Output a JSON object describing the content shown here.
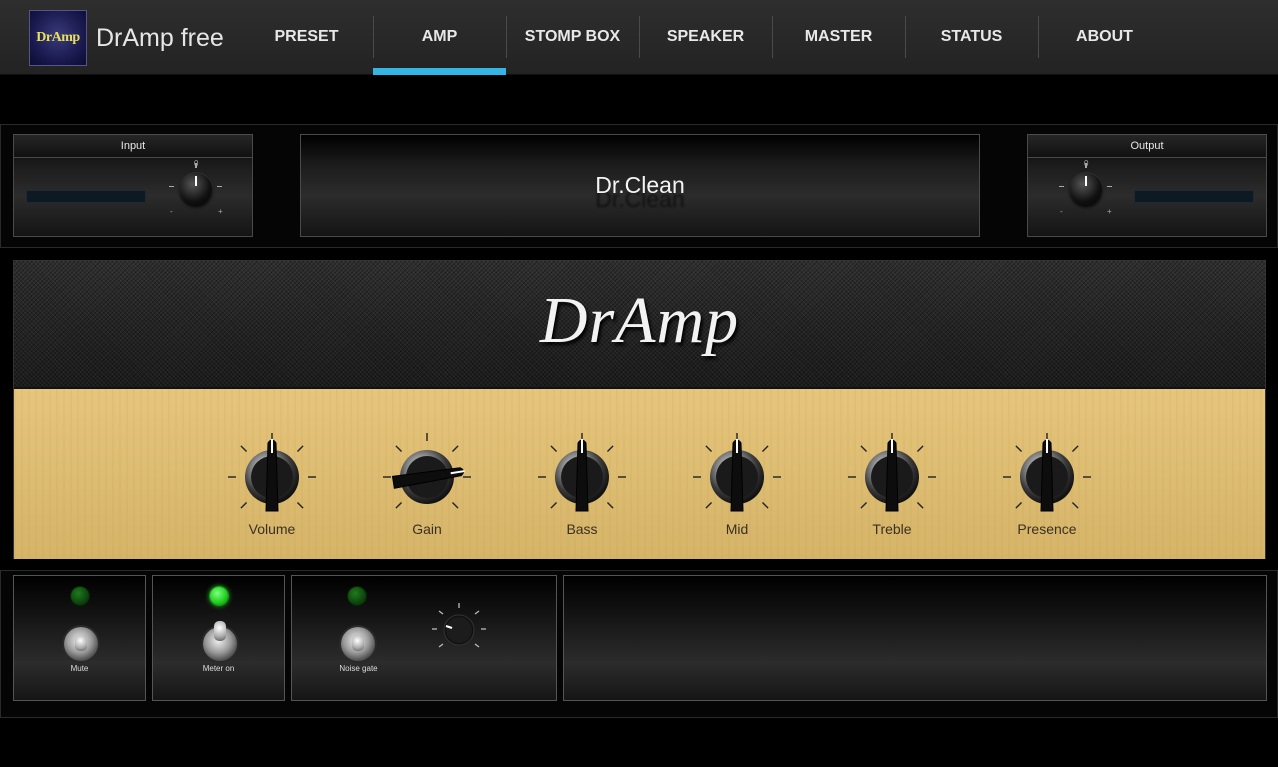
{
  "app": {
    "logo_text": "DrAmp",
    "title": "DrAmp free"
  },
  "tabs": [
    {
      "label": "PRESET",
      "active": false
    },
    {
      "label": "AMP",
      "active": true
    },
    {
      "label": "STOMP BOX",
      "active": false
    },
    {
      "label": "SPEAKER",
      "active": false
    },
    {
      "label": "MASTER",
      "active": false
    },
    {
      "label": "STATUS",
      "active": false
    },
    {
      "label": "ABOUT",
      "active": false
    }
  ],
  "input": {
    "title": "Input",
    "min_label": "-",
    "max_label": "+",
    "zero_label": "0"
  },
  "output": {
    "title": "Output",
    "min_label": "-",
    "max_label": "+",
    "zero_label": "0"
  },
  "preset": {
    "name": "Dr.Clean"
  },
  "amp": {
    "brand": "DrAmp",
    "knobs": [
      {
        "label": "Volume",
        "level": 0.5
      },
      {
        "label": "Gain",
        "level": 0.8
      },
      {
        "label": "Bass",
        "level": 0.5
      },
      {
        "label": "Mid",
        "level": 0.5
      },
      {
        "label": "Treble",
        "level": 0.5
      },
      {
        "label": "Presence",
        "level": 0.5
      }
    ]
  },
  "switches": {
    "mute": {
      "label": "Mute",
      "led": "off"
    },
    "meter": {
      "label": "Meter on",
      "led": "on"
    },
    "noise_gate": {
      "label": "Noise gate",
      "led": "off"
    }
  },
  "colors": {
    "accent": "#33b5e5",
    "faceplate": "#ddbd72",
    "led_on": "#2dff2d"
  }
}
